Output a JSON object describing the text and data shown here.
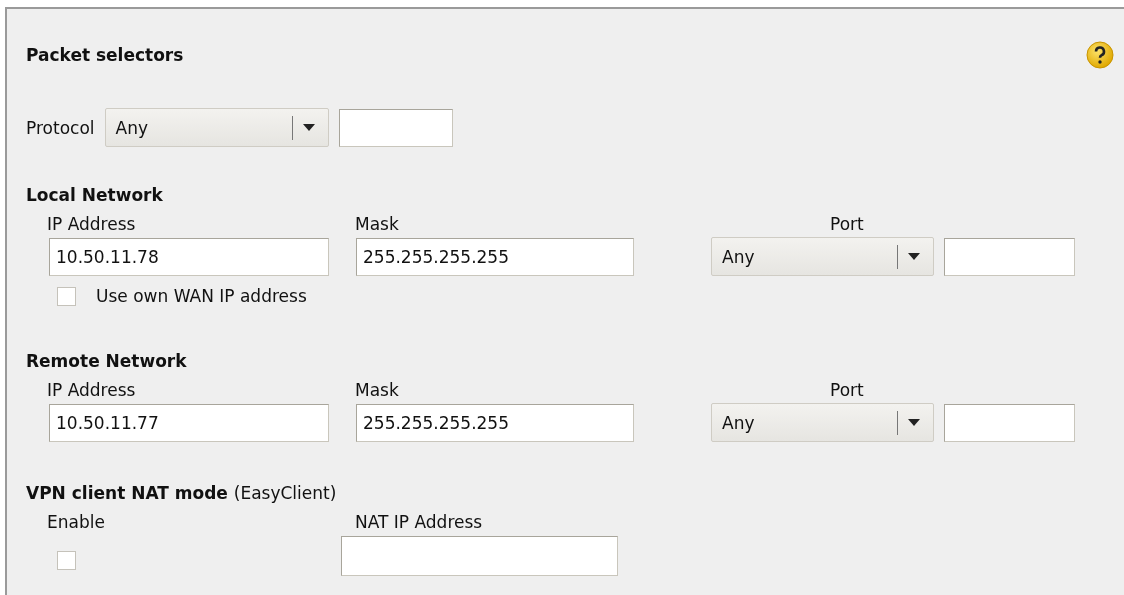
{
  "panel": {
    "title": "Packet selectors"
  },
  "protocol": {
    "label": "Protocol",
    "selected_option": "Any"
  },
  "networks": [
    {
      "heading": "Local Network",
      "ip_label": "IP Address",
      "ip_value": "10.50.11.78",
      "mask_label": "Mask",
      "mask_value": "255.255.255.255",
      "port_label": "Port",
      "port_option": "Any",
      "own_wan": {
        "label": "Use own WAN IP address",
        "checked": false
      }
    },
    {
      "heading": "Remote Network",
      "ip_label": "IP Address",
      "ip_value": "10.50.11.77",
      "mask_label": "Mask",
      "mask_value": "255.255.255.255",
      "port_label": "Port",
      "port_option": "Any"
    }
  ],
  "nat": {
    "heading": "VPN client NAT mode",
    "note": "(EasyClient)",
    "enable_label": "Enable",
    "enable_checked": false,
    "ip_label": "NAT IP Address"
  }
}
